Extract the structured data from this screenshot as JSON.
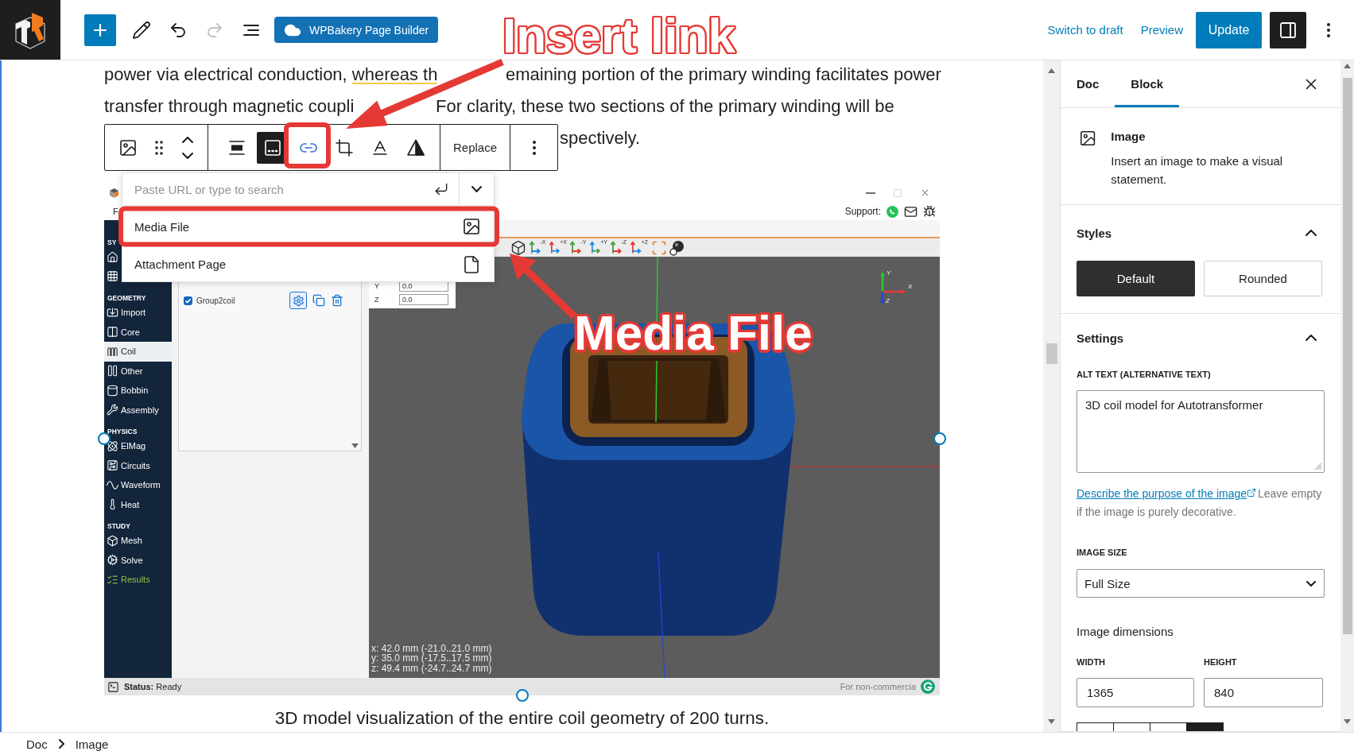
{
  "top_bar": {
    "tools": [
      {
        "kind": "inserter",
        "disabled": false
      },
      {
        "kind": "edit",
        "disabled": false
      },
      {
        "kind": "undo",
        "disabled": false
      },
      {
        "kind": "redo",
        "disabled": true
      },
      {
        "kind": "outline",
        "disabled": false
      }
    ],
    "builder_button": "WPBakery Page Builder",
    "switch_to_draft": "Switch to draft",
    "preview": "Preview",
    "update": "Update",
    "settings_toggle": {
      "pressed": true
    }
  },
  "paragraph": {
    "lines": [
      {
        "parts": [
          {
            "text": "power via electrical conduction, ",
            "flagged": false
          },
          {
            "text": "whereas th",
            "flagged": true
          },
          {
            "text": "emaining portion of the primary winding facilitates power",
            "flagged": false
          }
        ]
      },
      {
        "parts": [
          {
            "text": "transfer through magnetic coupli",
            "flagged": false
          },
          {
            "text": "For clarity, these two sections of the primary winding will be",
            "flagged": false
          }
        ]
      },
      {
        "parts": [
          {
            "text": "spectively.",
            "flagged": false
          }
        ]
      }
    ]
  },
  "block_toolbar": {
    "groups": [
      [
        {
          "kind": "image",
          "pressed": false,
          "open": false
        },
        {
          "kind": "drag",
          "pressed": false,
          "open": false
        },
        {
          "kind": "move",
          "pressed": false,
          "open": false
        }
      ],
      [
        {
          "kind": "align",
          "pressed": false,
          "open": false
        },
        {
          "kind": "caption",
          "pressed": true,
          "open": false
        },
        {
          "kind": "link",
          "pressed": false,
          "open": true
        },
        {
          "kind": "crop",
          "pressed": false,
          "open": false
        },
        {
          "kind": "text",
          "pressed": false,
          "open": false
        },
        {
          "kind": "duotone",
          "pressed": false,
          "open": false
        }
      ],
      [
        {
          "kind": "replace",
          "label": "Replace",
          "pressed": false,
          "open": false
        }
      ],
      [
        {
          "kind": "more",
          "pressed": false,
          "open": false
        }
      ]
    ]
  },
  "link_popover": {
    "placeholder": "Paste URL or type to search",
    "options": [
      {
        "kind": "media",
        "label": "Media File"
      },
      {
        "kind": "page",
        "label": "Attachment Page"
      }
    ]
  },
  "image_block": {
    "selected": true,
    "app": {
      "window_controls": [
        {
          "kind": "minimize",
          "disabled": false
        },
        {
          "kind": "maximize",
          "disabled": true
        },
        {
          "kind": "close",
          "disabled": false
        }
      ],
      "menu": [
        "F"
      ],
      "support": "Support:",
      "nav": [
        {
          "title": "SY",
          "items": [
            {
              "kind": "icon",
              "selected": false
            },
            {
              "kind": "icon",
              "selected": false
            }
          ]
        },
        {
          "title": "GEOMETRY",
          "items": [
            {
              "kind": "tool",
              "label": "Import",
              "selected": false
            },
            {
              "kind": "tool",
              "label": "Core",
              "selected": false
            },
            {
              "kind": "tool",
              "label": "Coil",
              "selected": true
            },
            {
              "kind": "tool",
              "label": "Other",
              "selected": false
            },
            {
              "kind": "tool",
              "label": "Bobbin",
              "selected": false
            },
            {
              "kind": "tool",
              "label": "Assembly",
              "selected": false
            }
          ]
        },
        {
          "title": "PHYSICS",
          "items": [
            {
              "kind": "tool",
              "label": "ElMag",
              "selected": false
            },
            {
              "kind": "tool",
              "label": "Circuits",
              "selected": false
            },
            {
              "kind": "tool",
              "label": "Waveform",
              "selected": false
            },
            {
              "kind": "tool",
              "label": "Heat",
              "selected": false
            }
          ]
        },
        {
          "title": "STUDY",
          "items": [
            {
              "kind": "tool",
              "label": "Mesh",
              "selected": false
            },
            {
              "kind": "tool",
              "label": "Solve",
              "selected": false
            },
            {
              "kind": "report",
              "label": "Results",
              "selected": false
            }
          ]
        }
      ],
      "list": [
        {
          "label": "Group2coil",
          "checked": true
        }
      ],
      "view_tools": [
        {
          "kind": "cube"
        },
        {
          "kind": "axis",
          "label": "-X"
        },
        {
          "kind": "axis",
          "label": "+X"
        },
        {
          "kind": "axis",
          "label": "-Y"
        },
        {
          "kind": "axis",
          "label": "+Y"
        },
        {
          "kind": "axis",
          "label": "-Z"
        },
        {
          "kind": "axis",
          "label": "+Z"
        },
        {
          "kind": "fit"
        },
        {
          "kind": "render"
        }
      ],
      "fields": [
        {
          "label": "Y",
          "value": "0.0"
        },
        {
          "label": "Z",
          "value": "0.0"
        }
      ],
      "triad": [
        "Y",
        "X",
        "Z"
      ],
      "readout": [
        "x: 42.0 mm (-21.0..21.0 mm)",
        "y: 35.0 mm (-17.5..17.5 mm)",
        "z: 49.4 mm (-24.7..24.7 mm)"
      ],
      "status": "**Status:** Ready",
      "notice": "For non-commercia"
    },
    "caption": "3D model visualization of the entire coil geometry of 200 turns."
  },
  "annotations": [
    {
      "text": "Insert link"
    },
    {
      "text": "Media File"
    }
  ],
  "sidebar": {
    "tabs": [
      {
        "label": "Doc",
        "selected": false
      },
      {
        "label": "Block",
        "selected": true
      }
    ],
    "block_card": {
      "title": "Image",
      "description": "Insert an image to make a visual statement."
    },
    "styles": {
      "title": "Styles",
      "expanded": true,
      "options": [
        {
          "label": "Default",
          "selected": true
        },
        {
          "label": "Rounded",
          "selected": false
        }
      ]
    },
    "settings": {
      "title": "Settings",
      "expanded": true,
      "alt_text": {
        "label": "ALT TEXT (ALTERNATIVE TEXT)",
        "value": "3D coil model for Autotransformer"
      },
      "help": {
        "link": "Describe the purpose of the image",
        "text": "Leave empty if the image is purely decorative."
      },
      "image_size": {
        "label": "IMAGE SIZE",
        "value": "Full Size"
      },
      "dimensions": {
        "title": "Image dimensions",
        "width": {
          "label": "WIDTH",
          "value": "1365"
        },
        "height": {
          "label": "HEIGHT",
          "value": "840"
        },
        "presets": [
          {
            "selected": false
          },
          {
            "selected": false
          },
          {
            "selected": false
          },
          {
            "selected": true
          }
        ]
      }
    }
  },
  "breadcrumbs": [
    "Doc",
    "Image"
  ]
}
